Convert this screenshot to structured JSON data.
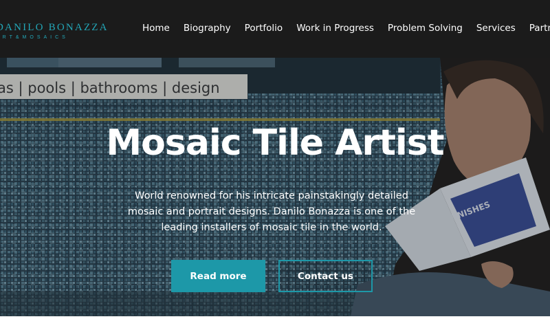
{
  "logo": {
    "name": "DANILO BONAZZA",
    "tagline": "ART&MOSAICS"
  },
  "nav": {
    "items": [
      {
        "label": "Home"
      },
      {
        "label": "Biography"
      },
      {
        "label": "Portfolio"
      },
      {
        "label": "Work in Progress"
      },
      {
        "label": "Problem Solving"
      },
      {
        "label": "Services"
      },
      {
        "label": "Partners"
      }
    ]
  },
  "hero": {
    "title": "Mosaic Tile Artist",
    "description": "World renowned for his intricate painstakingly detailed mosaic and portrait designs. Danilo Bonazza is one of the leading installers of mosaic tile in the world.",
    "banner_text": "as | pools | bathrooms | design",
    "booklet_text": "FINISHES",
    "primary_button": "Read more",
    "secondary_button": "Contact us"
  },
  "colors": {
    "accent": "#1d98a8",
    "header_bg": "#1b1b1b",
    "logo": "#23a7b8"
  }
}
